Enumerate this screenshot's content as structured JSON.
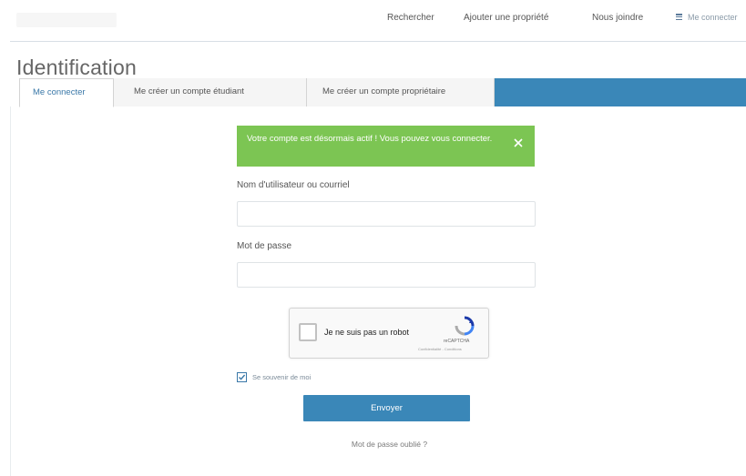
{
  "nav": {
    "items": [
      {
        "label": "Rechercher"
      },
      {
        "label": "Ajouter une propriété"
      },
      {
        "label": "Nous joindre"
      }
    ],
    "user_label": "Me connecter"
  },
  "page": {
    "title": "Identification"
  },
  "tabs": [
    {
      "label": "Me connecter",
      "active": true
    },
    {
      "label": "Me créer un compte étudiant",
      "active": false
    },
    {
      "label": "Me créer un compte propriétaire",
      "active": false
    }
  ],
  "alert": {
    "message": "Votre compte est désormais actif ! Vous pouvez vous connecter.",
    "color": "#7cc553"
  },
  "form": {
    "username_label": "Nom d'utilisateur ou courriel",
    "username_value": "",
    "password_label": "Mot de passe",
    "password_value": "",
    "remember_label": "Se souvenir de moi",
    "remember_checked": true,
    "submit_label": "Envoyer",
    "forgot_label": "Mot de passe oublié ?"
  },
  "recaptcha": {
    "label": "Je ne suis pas un robot",
    "brand": "reCAPTCHA",
    "terms": "Confidentialité - Conditions"
  },
  "colors": {
    "accent": "#3a87b8",
    "success": "#7cc553"
  }
}
